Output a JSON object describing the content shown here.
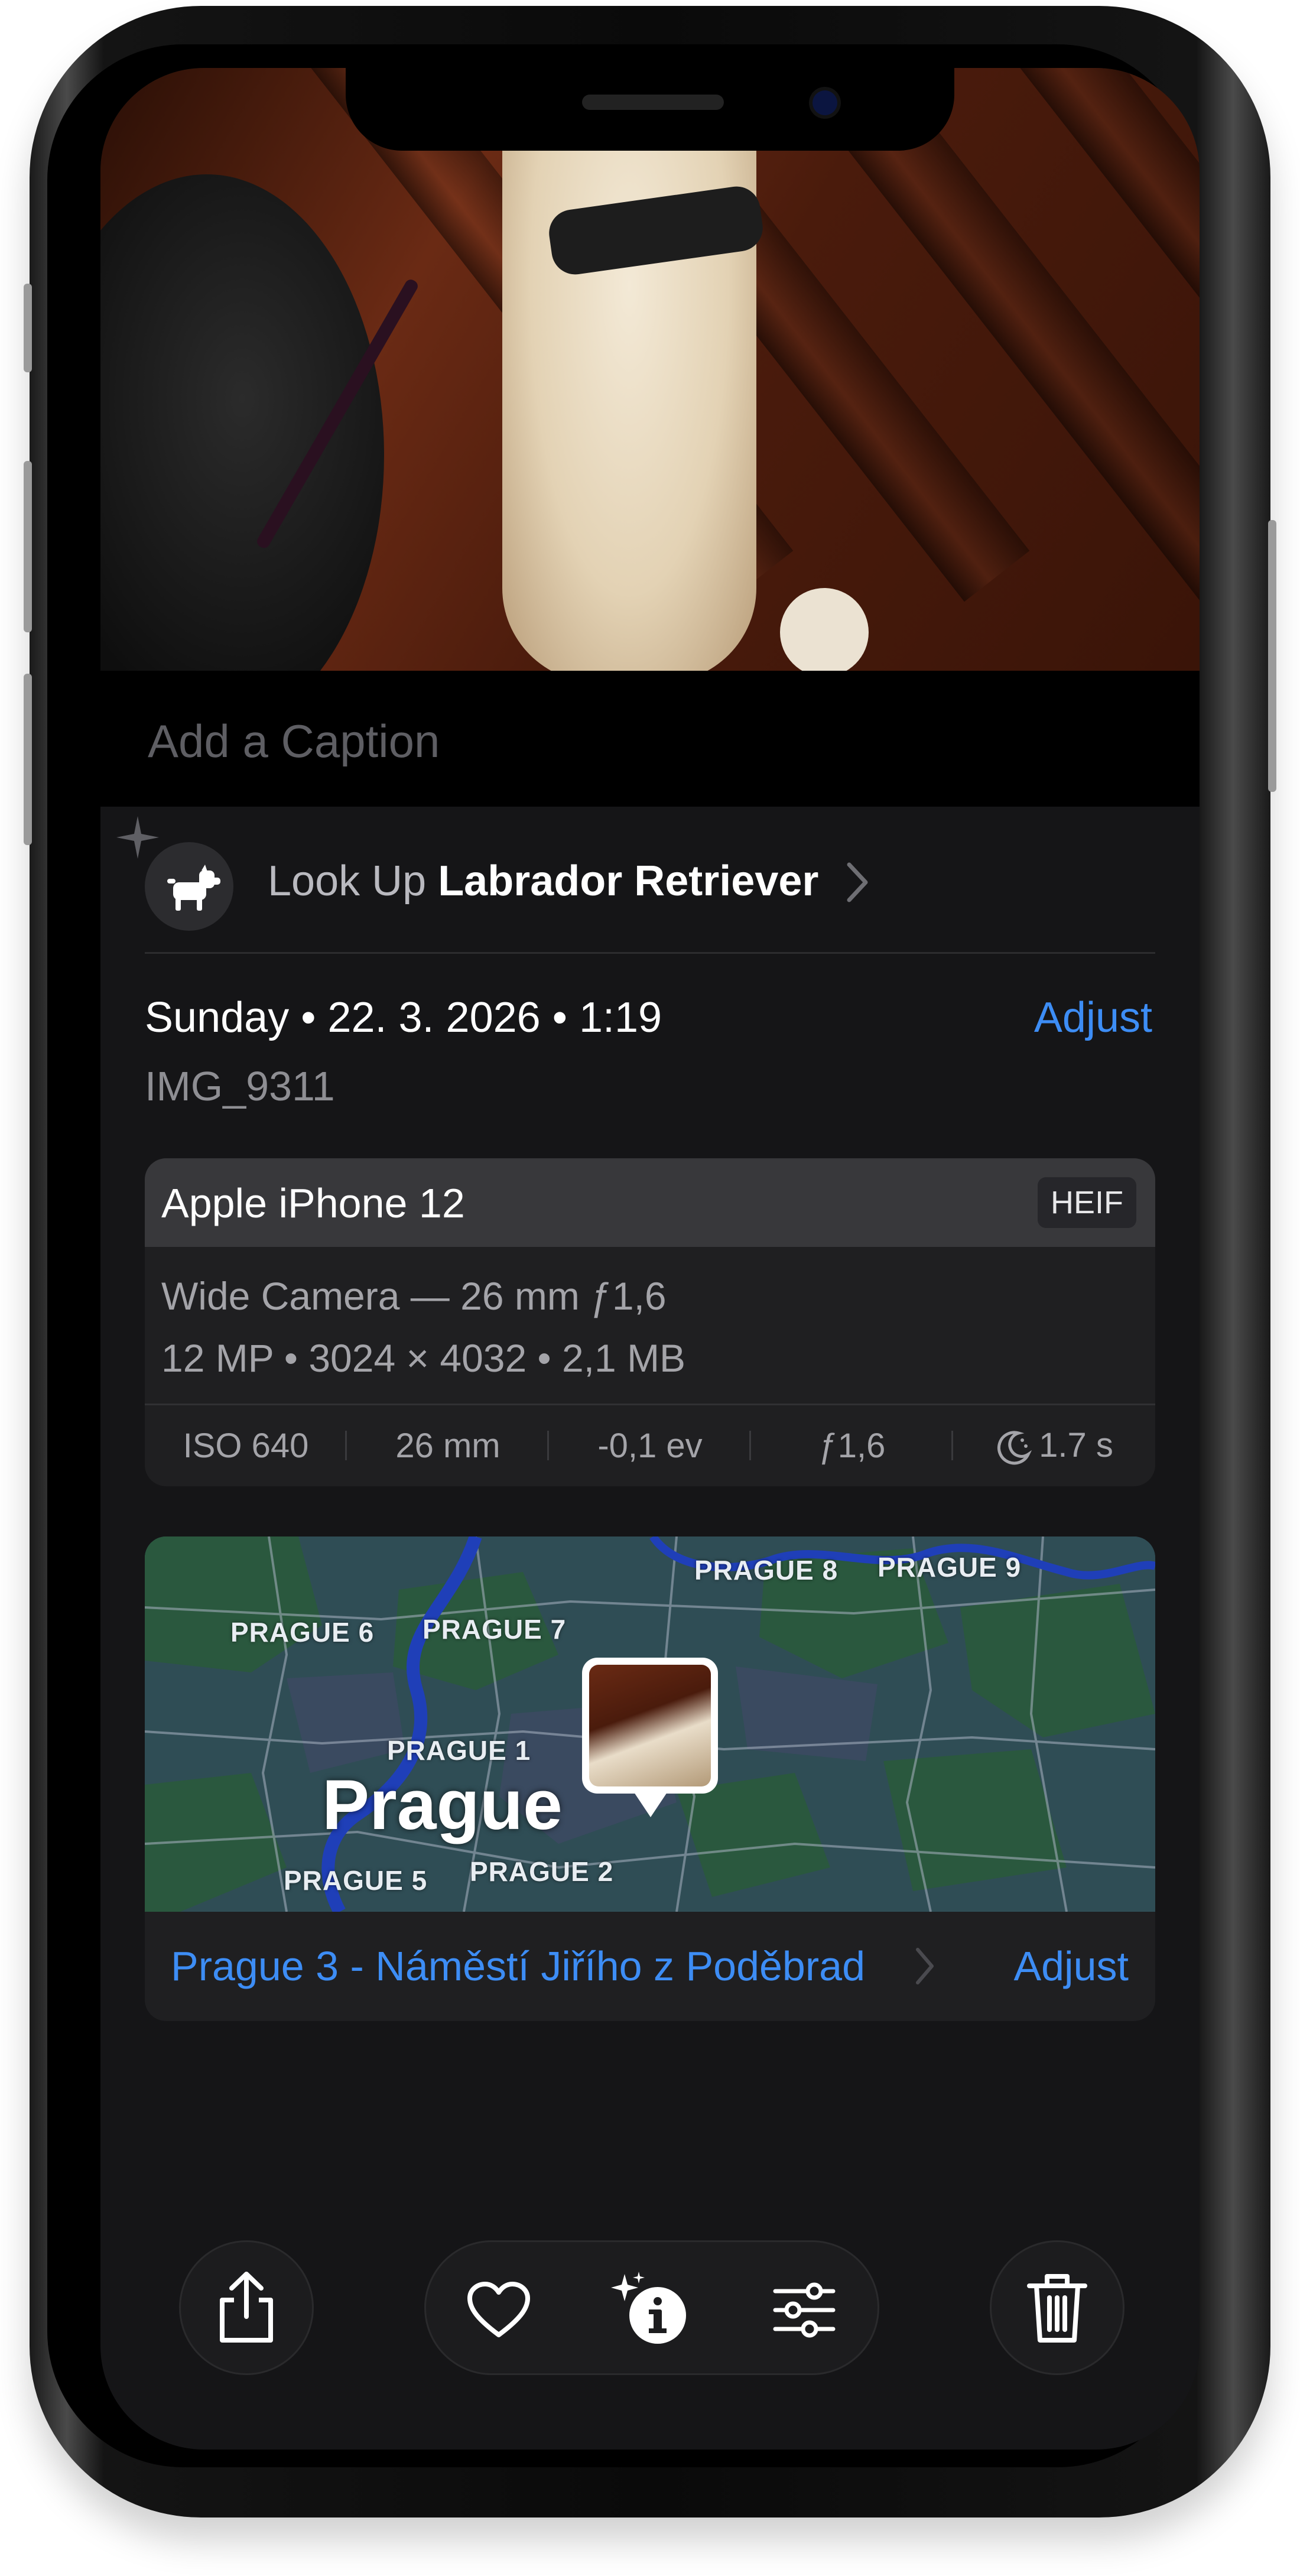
{
  "caption": {
    "placeholder": "Add a Caption"
  },
  "lookup": {
    "prefix": "Look Up",
    "subject": "Labrador Retriever"
  },
  "photo_info": {
    "date": "Sunday • 22. 3. 2026 • 1:19",
    "adjust_label": "Adjust",
    "filename": "IMG_9311"
  },
  "camera": {
    "device": "Apple iPhone 12",
    "format": "HEIF",
    "lens": "Wide Camera — 26 mm ƒ1,6",
    "specs": "12 MP • 3024 × 4032 • 2,1 MB",
    "exif": {
      "iso": "ISO 640",
      "focal": "26 mm",
      "ev": "-0,1 ev",
      "aperture": "ƒ1,6",
      "shutter": "1.7 s"
    }
  },
  "map": {
    "city": "Prague",
    "districts": [
      "PRAGUE 8",
      "PRAGUE 9",
      "PRAGUE 6",
      "PRAGUE 7",
      "PRAGUE 1",
      "PRAGUE 5",
      "PRAGUE 2"
    ],
    "location": "Prague 3 - Náměstí Jiřího z Poděbrad",
    "adjust_label": "Adjust"
  },
  "toolbar": {
    "icons": [
      "share-icon",
      "heart-icon",
      "info-sparkle-icon",
      "adjust-sliders-icon",
      "trash-icon"
    ]
  },
  "colors": {
    "accent": "#3d8df5",
    "background": "#151517",
    "card": "#1f1f21"
  }
}
